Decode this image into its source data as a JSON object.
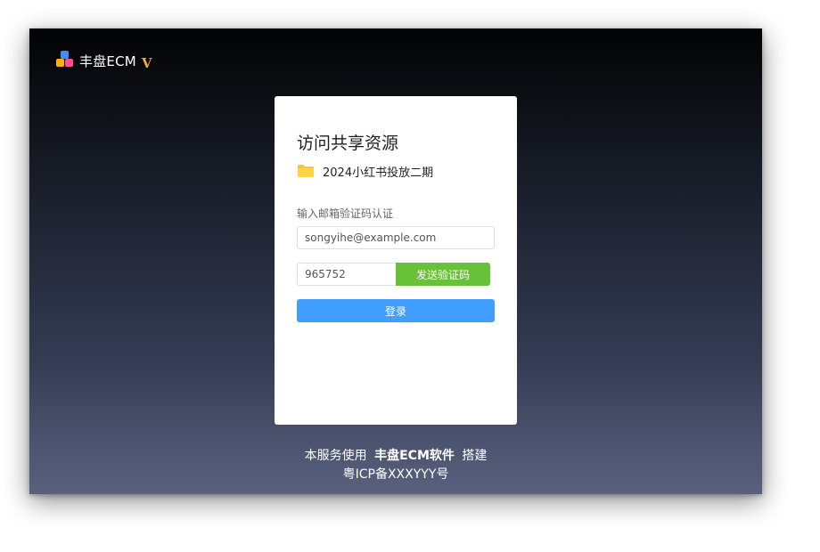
{
  "brand": {
    "name": "丰盘ECM",
    "badge": "V"
  },
  "card": {
    "title": "访问共享资源",
    "file": {
      "name": "2024小红书投放二期",
      "icon": "folder-icon"
    },
    "auth_label": "输入邮箱验证码认证",
    "email_value": "songyihe@example.com",
    "code_value": "965752",
    "send_code_label": "发送验证码",
    "login_label": "登录"
  },
  "footer": {
    "prefix": "本服务使用",
    "product": "丰盘ECM软件",
    "suffix": "搭建",
    "icp": "粤ICP备XXXYYY号"
  },
  "colors": {
    "send_button": "#67c23a",
    "login_button": "#409eff",
    "brand_badge": "#f0a83a",
    "folder": "#f7c531"
  }
}
